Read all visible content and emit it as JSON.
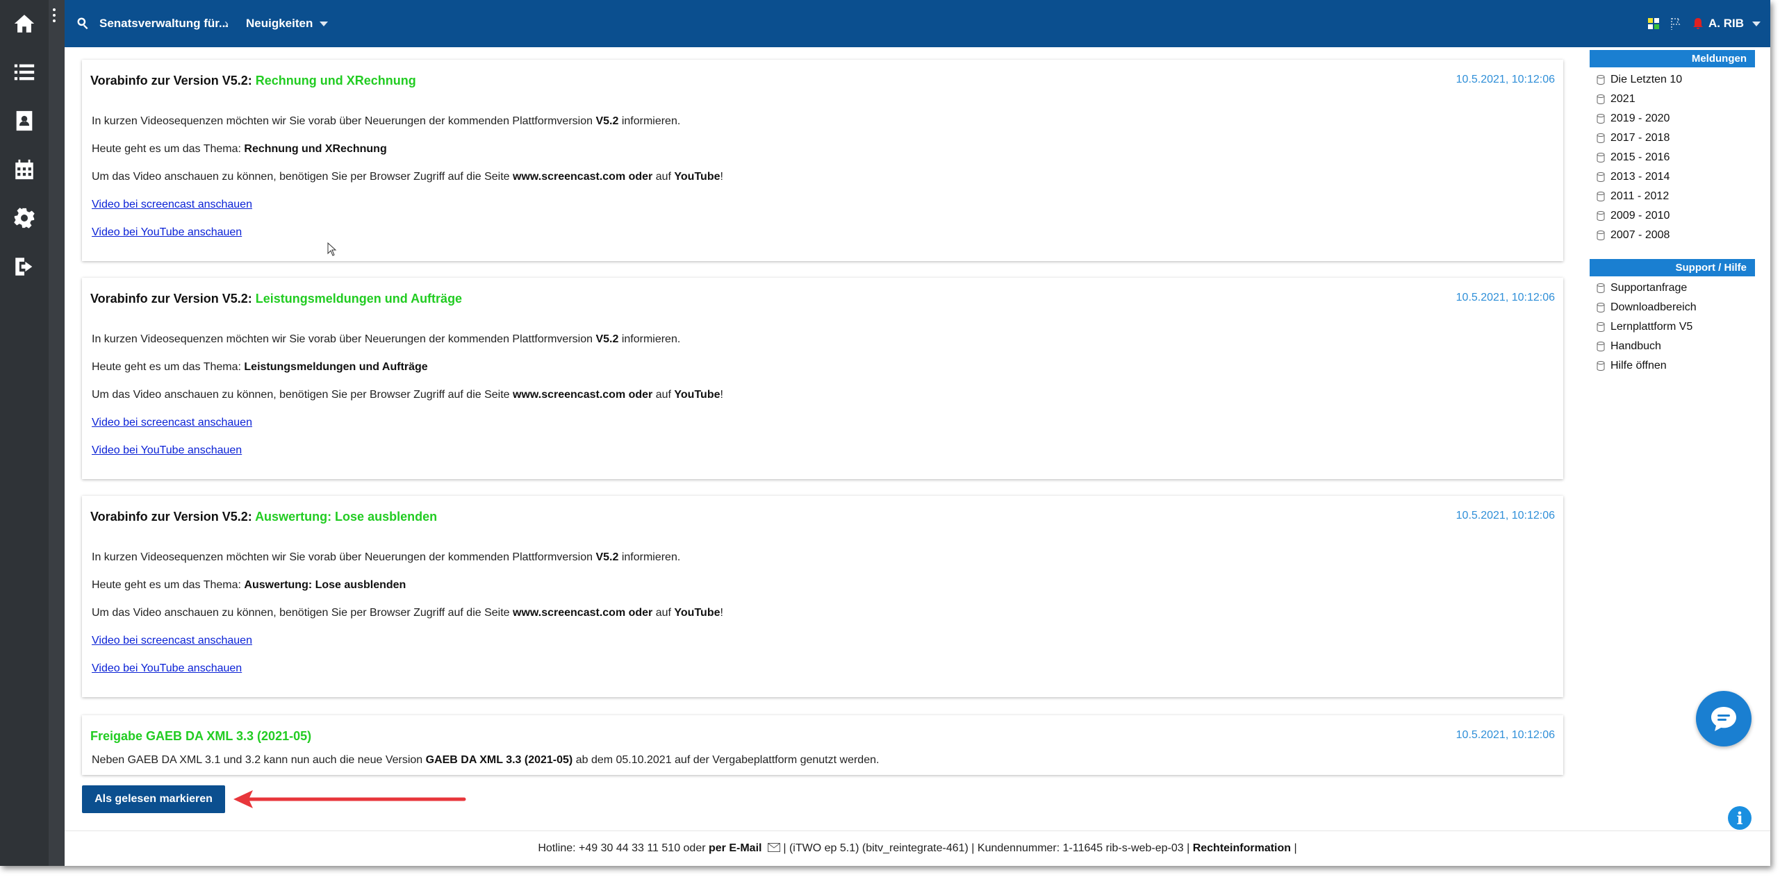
{
  "topbar": {
    "organization": "Senatsverwaltung für...",
    "page": "Neuigkeiten",
    "user": "A. RIB"
  },
  "rail": {
    "icons": [
      "home-icon",
      "list-icon",
      "contacts-icon",
      "calendar-icon",
      "settings-icon",
      "logout-icon"
    ]
  },
  "news": [
    {
      "title_prefix": "Vorabinfo zur Version V5.2:",
      "title_highlight": "Rechnung und XRechnung",
      "date": "10.5.2021, 10:12:06",
      "intro_a": "In kurzen Videosequenzen möchten wir Sie vorab über Neuerungen der kommenden Plattformversion ",
      "intro_b": "V5.2",
      "intro_c": " informieren.",
      "topic_label": "Heute geht es um das Thema: ",
      "topic": "Rechnung und XRechnung",
      "access_a": "Um das Video anschauen zu können, benötigen Sie per Browser Zugriff auf die Seite ",
      "access_b": "www.screencast.com oder",
      "access_c": " auf ",
      "access_d": "YouTube",
      "access_e": "!",
      "link_screencast": "Video bei screencast anschauen",
      "link_youtube": "Video bei YouTube anschauen"
    },
    {
      "title_prefix": "Vorabinfo zur Version V5.2:",
      "title_highlight": "Leistungsmeldungen und Aufträge",
      "date": "10.5.2021, 10:12:06",
      "intro_a": "In kurzen Videosequenzen möchten wir Sie vorab über Neuerungen der kommenden Plattformversion ",
      "intro_b": "V5.2",
      "intro_c": " informieren.",
      "topic_label": "Heute geht es um das Thema: ",
      "topic": "Leistungsmeldungen und Aufträge",
      "access_a": "Um das Video anschauen zu können, benötigen Sie per Browser Zugriff auf die Seite ",
      "access_b": "www.screencast.com oder",
      "access_c": " auf ",
      "access_d": "YouTube",
      "access_e": "!",
      "link_screencast": "Video bei screencast anschauen",
      "link_youtube": "Video bei YouTube anschauen"
    },
    {
      "title_prefix": "Vorabinfo zur Version V5.2:",
      "title_highlight": "Auswertung: Lose ausblenden",
      "date": "10.5.2021, 10:12:06",
      "intro_a": "In kurzen Videosequenzen möchten wir Sie vorab über Neuerungen der kommenden Plattformversion ",
      "intro_b": "V5.2",
      "intro_c": " informieren.",
      "topic_label": "Heute geht es um das Thema: ",
      "topic": "Auswertung: Lose ausblenden",
      "access_a": "Um das Video anschauen zu können, benötigen Sie per Browser Zugriff auf die Seite ",
      "access_b": "www.screencast.com oder",
      "access_c": " auf ",
      "access_d": "YouTube",
      "access_e": "!",
      "link_screencast": "Video bei screencast anschauen",
      "link_youtube": "Video bei YouTube anschauen"
    }
  ],
  "gaeb": {
    "title": "Freigabe GAEB DA XML 3.3 (2021-05)",
    "date": "10.5.2021, 10:12:06",
    "text_a": "Neben GAEB DA XML 3.1 und 3.2 kann nun auch die neue Version ",
    "text_b": "GAEB DA XML 3.3 (2021-05)",
    "text_c": " ab dem 05.10.2021 auf der Vergabeplattform genutzt werden."
  },
  "mark_read_label": "Als gelesen markieren",
  "sidebar": {
    "meldungen_title": "Meldungen",
    "meldungen": [
      "Die Letzten 10",
      "2021",
      "2019 - 2020",
      "2017 - 2018",
      "2015 - 2016",
      "2013 - 2014",
      "2011 - 2012",
      "2009 - 2010",
      "2007 - 2008"
    ],
    "support_title": "Support / Hilfe",
    "support": [
      "Supportanfrage",
      "Downloadbereich",
      "Lernplattform V5",
      "Handbuch",
      "Hilfe öffnen"
    ]
  },
  "footer": {
    "hotline": "Hotline: +49 30 44 33 11 510 oder ",
    "email": "per E-Mail",
    "version": " |  (iTWO ep 5.1) (bitv_reintegrate-461)  |  Kundennummer: 1-11645 rib-s-web-ep-03 | ",
    "legal": "Rechteinformation",
    "end": "  |"
  },
  "colors": {
    "brand": "#0b4f8f",
    "accent": "#1a7fd1",
    "highlight": "#22cc22",
    "date": "#2f8fd8",
    "link": "#0b22d6"
  }
}
